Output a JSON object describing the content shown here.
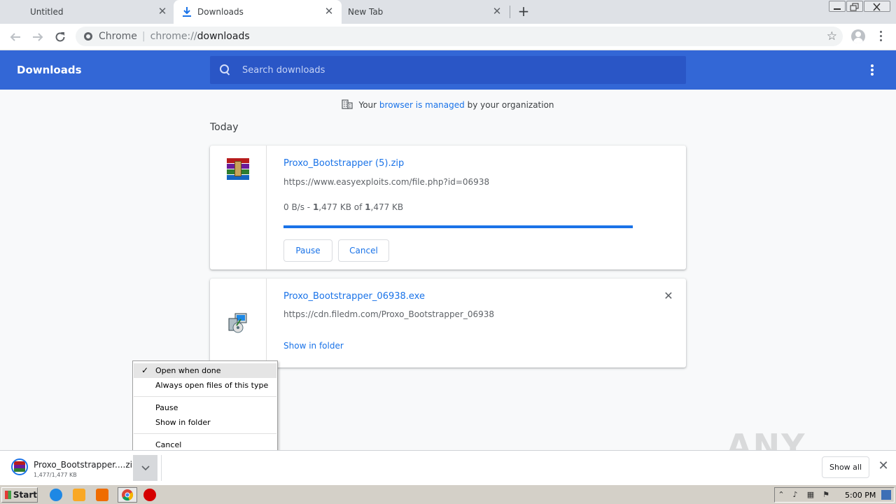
{
  "tabs": [
    {
      "label": "Untitled",
      "active": false
    },
    {
      "label": "Downloads",
      "active": true,
      "icon": "download-icon"
    },
    {
      "label": "New Tab",
      "active": false
    }
  ],
  "omnibox": {
    "chip": "Chrome",
    "scheme": "chrome://",
    "path": "downloads"
  },
  "header": {
    "title": "Downloads",
    "search_placeholder": "Search downloads"
  },
  "managed": {
    "prefix": "Your",
    "link": "browser is managed",
    "suffix": "by your organization"
  },
  "section_label": "Today",
  "downloads": [
    {
      "name": "Proxo_Bootstrapper (5).zip",
      "url": "https://www.easyexploits.com/file.php?id=06938",
      "status_speed": "0 B/s - ",
      "status_done": "1",
      "status_done_rest": ",477 KB of ",
      "status_total": "1",
      "status_total_rest": ",477 KB",
      "progress": 1.0,
      "pause_label": "Pause",
      "cancel_label": "Cancel"
    },
    {
      "name": "Proxo_Bootstrapper_06938.exe",
      "url": "https://cdn.filedm.com/Proxo_Bootstrapper_06938",
      "show_in_folder": "Show in folder"
    }
  ],
  "context_menu": {
    "open_when_done": "Open when done",
    "always_open": "Always open files of this type",
    "pause": "Pause",
    "show_in_folder": "Show in folder",
    "cancel": "Cancel"
  },
  "shelf": {
    "name": "Proxo_Bootstrapper....zip",
    "size": "1,477/1,477 KB",
    "show_all": "Show all"
  },
  "watermark": "ANY RUN",
  "taskbar": {
    "start": "Start",
    "time": "5:00 PM"
  },
  "colors": {
    "accent": "#1a73e8",
    "header": "#3367d6",
    "search_bg": "#2a56c6"
  }
}
